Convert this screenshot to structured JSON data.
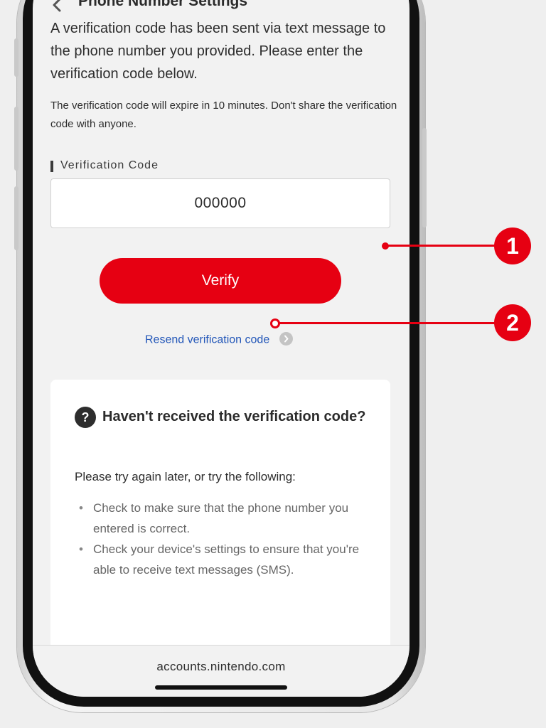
{
  "header": {
    "title": "Phone Number Settings",
    "back_icon": "chevron-left-icon"
  },
  "main": {
    "intro": "A verification code has been sent via text message to the phone number you provided. Please enter the verification code below.",
    "note": "The verification code will expire in 10 minutes. Don't share the verification code with anyone.",
    "field_label": "Verification Code",
    "code_value": "000000",
    "verify_label": "Verify",
    "resend_label": "Resend verification code",
    "resend_icon": "chevron-right-circle-icon"
  },
  "help": {
    "icon": "question-circle-icon",
    "icon_glyph": "?",
    "title": "Haven't received the verification code?",
    "intro": "Please try again later, or try the following:",
    "items": [
      "Check to make sure that the phone number you entered is correct.",
      "Check your device's settings to ensure that you're able to receive text messages (SMS)."
    ]
  },
  "browser": {
    "url": "accounts.nintendo.com"
  },
  "callouts": [
    "1",
    "2"
  ],
  "colors": {
    "accent": "#e60012",
    "link": "#2256b8",
    "screen_bg": "#f2f2f2"
  }
}
